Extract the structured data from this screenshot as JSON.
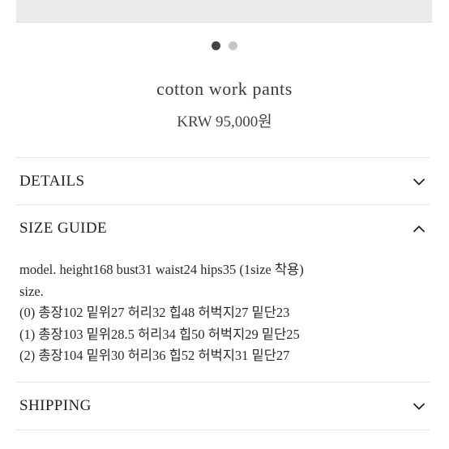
{
  "carousel": {
    "count": 2,
    "active": 0
  },
  "product": {
    "title": "cotton work pants",
    "price": "KRW 95,000원"
  },
  "sections": {
    "details": {
      "label": "DETAILS",
      "icon": "chevron-down-icon",
      "expanded": false
    },
    "size_guide": {
      "label": "SIZE GUIDE",
      "icon": "chevron-up-icon",
      "expanded": true,
      "lines": [
        "model. height168 bust31 waist24 hips35 (1size 착용)",
        "size.",
        "(0) 총장102 밑위27 허리32 힙48 허벅지27 밑단23",
        "(1) 총장103 밑위28.5 허리34 힙50 허벅지29 밑단25",
        "(2) 총장104 밑위30 허리36 힙52 허벅지31 밑단27"
      ]
    },
    "shipping": {
      "label": "SHIPPING",
      "icon": "chevron-down-icon",
      "expanded": false
    }
  }
}
